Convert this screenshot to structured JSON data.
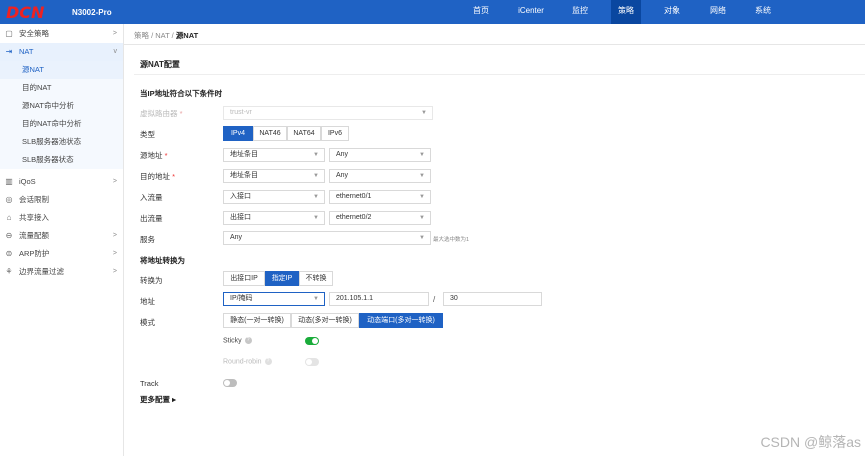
{
  "header": {
    "logo": "DCN",
    "model": "N3002-Pro",
    "nav": [
      "首页",
      "iCenter",
      "监控",
      "策略",
      "对象",
      "网络",
      "系统"
    ],
    "active_nav": "策略"
  },
  "sidebar": {
    "items": [
      {
        "icon": "shield-icon",
        "label": "安全策略",
        "arrow": ">"
      },
      {
        "icon": "nat-icon",
        "label": "NAT",
        "arrow": "v"
      },
      {
        "label": "源NAT"
      },
      {
        "label": "目的NAT"
      },
      {
        "label": "源NAT命中分析"
      },
      {
        "label": "目的NAT命中分析"
      },
      {
        "label": "SLB服务器池状态"
      },
      {
        "label": "SLB服务器状态"
      },
      {
        "icon": "chart-icon",
        "label": "iQoS",
        "arrow": ">"
      },
      {
        "icon": "session-icon",
        "label": "会话限制"
      },
      {
        "icon": "share-icon",
        "label": "共享接入"
      },
      {
        "icon": "flow-icon",
        "label": "流量配额",
        "arrow": ">"
      },
      {
        "icon": "arp-icon",
        "label": "ARP防护",
        "arrow": ">"
      },
      {
        "icon": "filter-icon",
        "label": "边界流量过滤",
        "arrow": ">"
      }
    ]
  },
  "breadcrumb": {
    "prefix": "策略 / NAT / ",
    "current": "源NAT"
  },
  "panel": {
    "title": "源NAT配置"
  },
  "form": {
    "match_section": "当IP地址符合以下条件时",
    "vrouter": {
      "label": "虚拟路由器",
      "req": "*",
      "value": "trust-vr"
    },
    "type": {
      "label": "类型",
      "options": [
        "IPv4",
        "NAT46",
        "NAT64",
        "IPv6"
      ],
      "selected": "IPv4"
    },
    "src": {
      "label": "源地址",
      "req": "*",
      "value1": "地址条目",
      "value2": "Any"
    },
    "dst": {
      "label": "目的地址",
      "req": "*",
      "value1": "地址条目",
      "value2": "Any"
    },
    "ingress": {
      "label": "入流量",
      "value1": "入接口",
      "value2": "ethernet0/1"
    },
    "egress": {
      "label": "出流量",
      "value1": "出接口",
      "value2": "ethernet0/2"
    },
    "service": {
      "label": "服务",
      "value": "Any",
      "hint": "最大选中数为1"
    },
    "translate_section": "将地址转换为",
    "translate_to": {
      "label": "转换为",
      "options": [
        "出接口IP",
        "指定IP",
        "不转换"
      ],
      "selected": "指定IP"
    },
    "address": {
      "label": "地址",
      "type": "IP/掩码",
      "ip": "201.105.1.1",
      "slash": "/",
      "mask": "30"
    },
    "mode": {
      "label": "模式",
      "options": [
        "静态(一对一转换)",
        "动态(多对一转换)",
        "动态端口(多对一转换)"
      ],
      "selected": "动态端口(多对一转换)"
    },
    "sticky": {
      "label": "Sticky",
      "qmark": "?",
      "on": true
    },
    "round_robin": {
      "label": "Round-robin",
      "qmark": "?",
      "on": false,
      "disabled": true
    },
    "track": {
      "label": "Track",
      "on": false
    },
    "more": "更多配置 ▸"
  },
  "caret": "▼",
  "watermark": "CSDN @鲸落as"
}
